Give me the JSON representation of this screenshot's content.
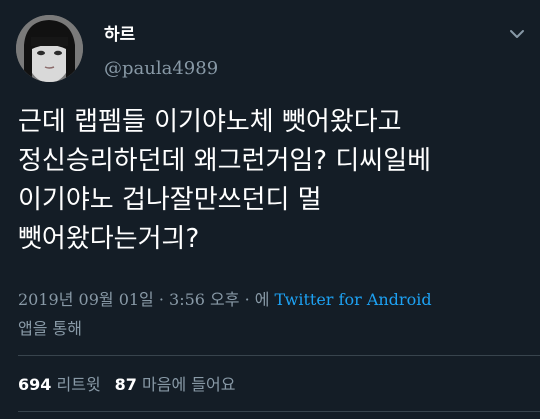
{
  "user": {
    "display_name": "하르",
    "handle": "@paula4989",
    "avatar_icon": "avatar-photo"
  },
  "tweet": {
    "text": "근데 랩펨들 이기야노체 뺏어왔다고\n정신승리하던데 왜그런거임? 디씨일베\n이기야노 겁나잘만쓰던디 멀\n뺏어왔다는거긔?",
    "timestamp_prefix": "2019년 09월 01일 · 3:56 오후 · 에 ",
    "source": "Twitter for Android",
    "source_suffix": "앱을 통해"
  },
  "stats": {
    "retweets_count": "694",
    "retweets_label": "리트윗",
    "likes_count": "87",
    "likes_label": "마음에 들어요"
  },
  "colors": {
    "background": "#141d26",
    "secondary_text": "#8899a6",
    "link": "#1da1f2",
    "divider": "#38444d"
  }
}
